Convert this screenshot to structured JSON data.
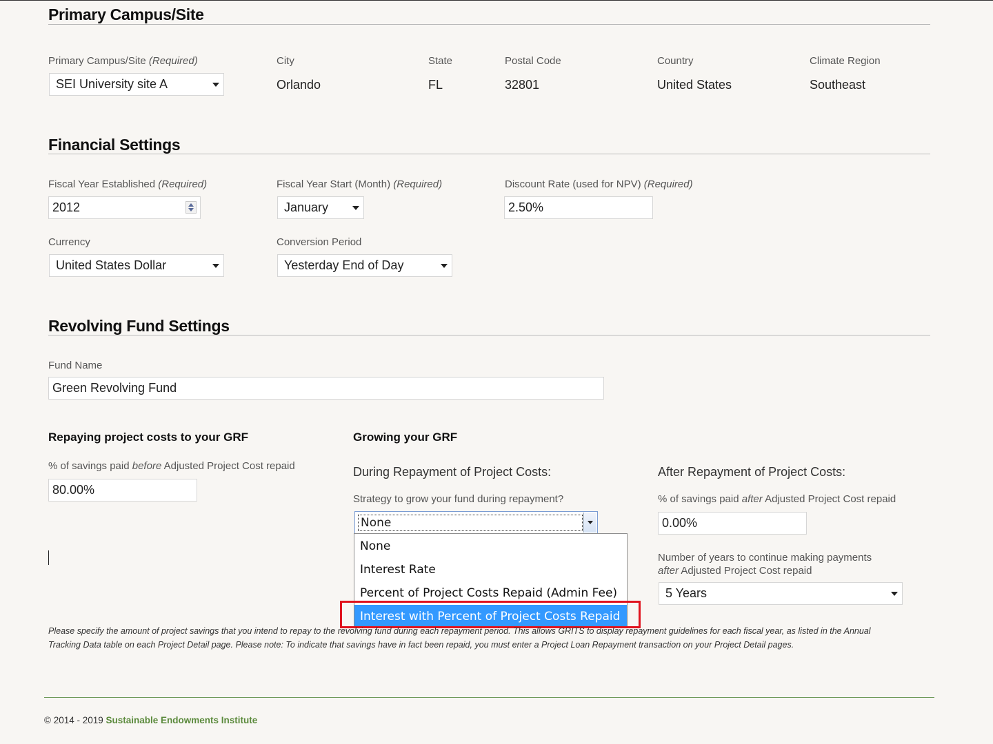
{
  "campus": {
    "heading": "Primary Campus/Site",
    "site_label": "Primary Campus/Site",
    "required": "(Required)",
    "site_value": "SEI University site A",
    "city_label": "City",
    "city_value": "Orlando",
    "state_label": "State",
    "state_value": "FL",
    "postal_label": "Postal Code",
    "postal_value": "32801",
    "country_label": "Country",
    "country_value": "United States",
    "climate_label": "Climate Region",
    "climate_value": "Southeast"
  },
  "financial": {
    "heading": "Financial Settings",
    "fy_established_label": "Fiscal Year Established",
    "fy_established_value": "2012",
    "fy_start_label": "Fiscal Year Start (Month)",
    "fy_start_value": "January",
    "discount_label": "Discount Rate (used for NPV)",
    "discount_value": "2.50%",
    "currency_label": "Currency",
    "currency_value": "United States Dollar",
    "conversion_label": "Conversion Period",
    "conversion_value": "Yesterday End of Day",
    "required": "(Required)"
  },
  "revolving": {
    "heading": "Revolving Fund Settings",
    "fund_name_label": "Fund Name",
    "fund_name_value": "Green Revolving Fund",
    "repaying_heading": "Repaying project costs to your GRF",
    "before_label_pre": "% of savings paid ",
    "before_label_em": "before",
    "before_label_post": " Adjusted Project Cost repaid",
    "before_value": "80.00%",
    "growing_heading": "Growing your GRF",
    "during_heading": "During Repayment of Project Costs:",
    "strategy_label": "Strategy to grow your fund during repayment?",
    "strategy_value": "None",
    "strategy_options": [
      "None",
      "Interest Rate",
      "Percent of Project Costs Repaid (Admin Fee)",
      "Interest with Percent of Project Costs Repaid"
    ],
    "after_heading": "After Repayment of Project Costs:",
    "after_label_pre": "% of savings paid ",
    "after_label_em": "after",
    "after_label_post": " Adjusted Project Cost repaid",
    "after_value": "0.00%",
    "years_label_line1": "Number of years to continue making payments",
    "years_label_em": "after",
    "years_label_post": " Adjusted Project Cost repaid",
    "years_value": "5 Years",
    "note_line1": "Please specify the amount of project savings that you intend to repay to the revolving fund during each repayment period. This allows GRITS to display repayment guidelines for each fiscal year, as listed in the Annual",
    "note_line2": "Tracking Data table on each Project Detail page. Please note: To indicate that savings have in fact been repaid, you must enter a Project Loan Repayment transaction on your Project Detail pages."
  },
  "footer": {
    "copyright": "© 2014 - 2019 ",
    "org_link": "Sustainable Endowments Institute"
  }
}
